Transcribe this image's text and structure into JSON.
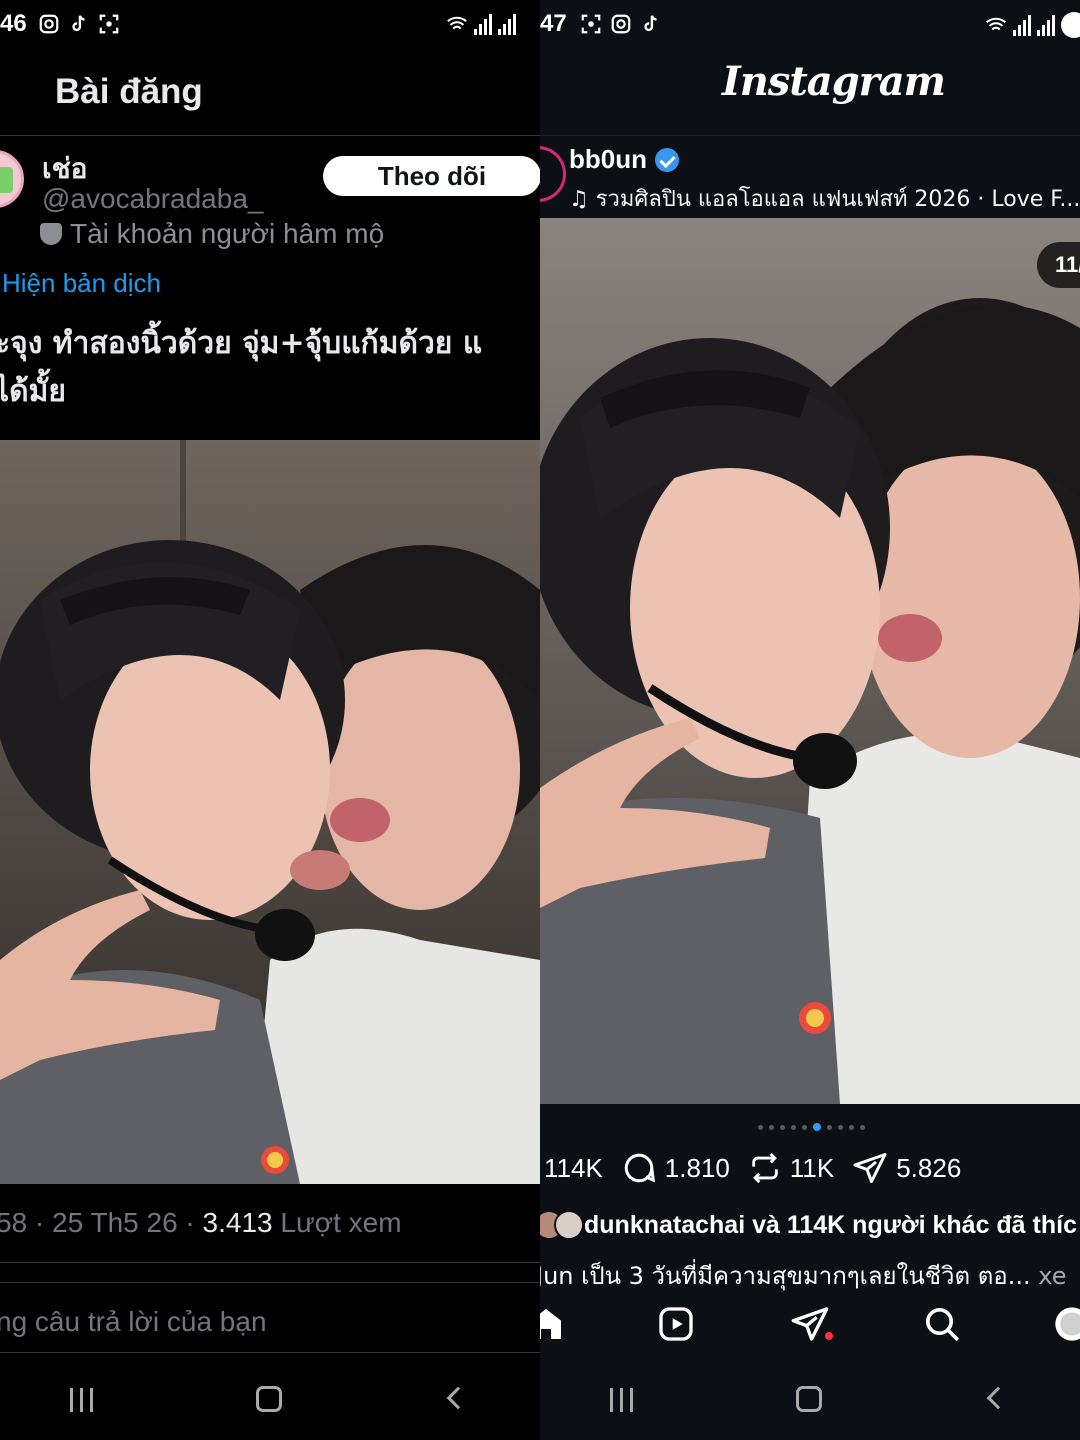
{
  "left": {
    "status": {
      "time": "46"
    },
    "header_title": "Bài đăng",
    "author": {
      "name": "เช่อ",
      "handle": "@avocabradaba_",
      "fan_label": "Tài khoản người hâm mộ"
    },
    "follow_label": "Theo dõi",
    "translate_label": "Hiện bản dịch",
    "post_text_line1": "ะจุง ทำสองนิ้วด้วย จุ่ม+จุ้บแก้มด้วย แ",
    "post_text_line2": "ได้มั้ย",
    "meta": {
      "time": "58",
      "date": "25 Th5 26",
      "views_count": "3.413",
      "views_label": "Lượt xem"
    },
    "reply_placeholder": "ng câu trả lời của bạn"
  },
  "right": {
    "status": {
      "time": "47"
    },
    "logo": "Instagram",
    "username": "bb0un",
    "music": "รวมศิลปิน แอลโอแอล แฟนเฟสท์ 2026 · Love F...",
    "counter": "11/",
    "actions": {
      "likes": "114K",
      "comments": "1.810",
      "reposts": "11K",
      "shares": "5.826"
    },
    "liked_by": "dunknatachai và 114K người khác đã thíc",
    "caption": "Jun เป็น 3 วันที่มีความสุขมากๆเลยในชีวิต ตอ...",
    "caption_more": "xe"
  },
  "colors": {
    "x_link": "#1d9bf0",
    "ig_accent": "#3797f0",
    "ig_bg": "#0c1014",
    "notif_red": "#ff3040"
  }
}
